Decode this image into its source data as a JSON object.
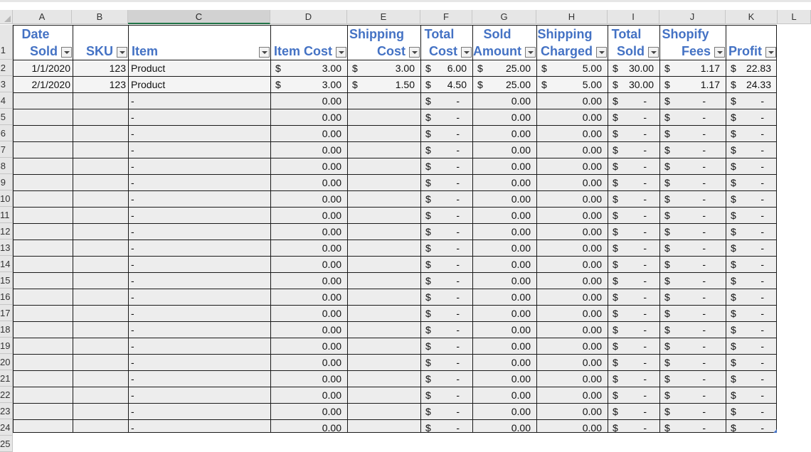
{
  "columns": [
    "A",
    "B",
    "C",
    "D",
    "E",
    "F",
    "G",
    "H",
    "I",
    "J",
    "K",
    "L"
  ],
  "row_numbers": [
    "1",
    "2",
    "3",
    "4",
    "5",
    "6",
    "7",
    "8",
    "9",
    "10",
    "11",
    "12",
    "13",
    "14",
    "15",
    "16",
    "17",
    "18",
    "19",
    "20",
    "21",
    "22",
    "23",
    "24",
    "25"
  ],
  "headers": {
    "date_sold": [
      "Date",
      "Sold"
    ],
    "sku": "SKU",
    "item": "Item",
    "item_cost": "Item Cost",
    "shipping_cost": [
      "Shipping",
      "Cost"
    ],
    "total_cost": [
      "Total",
      "Cost"
    ],
    "sold_amount": [
      "Sold",
      "Amount"
    ],
    "shipping_charged": [
      "Shipping",
      "Charged"
    ],
    "total_sold": [
      "Total",
      "Sold"
    ],
    "shopify_fees": [
      "Shopify",
      "Fees"
    ],
    "profit": "Profit"
  },
  "rows": [
    {
      "date": "1/1/2020",
      "sku": "123",
      "item": "Product",
      "item_cost": "3.00",
      "ship_cost": "3.00",
      "total_cost": "6.00",
      "sold_amount": "25.00",
      "ship_charged": "5.00",
      "total_sold": "30.00",
      "fees": "1.17",
      "profit": "22.83"
    },
    {
      "date": "2/1/2020",
      "sku": "123",
      "item": "Product",
      "item_cost": "3.00",
      "ship_cost": "1.50",
      "total_cost": "4.50",
      "sold_amount": "25.00",
      "ship_charged": "5.00",
      "total_sold": "30.00",
      "fees": "1.17",
      "profit": "24.33"
    }
  ],
  "empty_rows": {
    "count": 22,
    "item": "-",
    "item_cost": "0.00",
    "dash": "-",
    "sold_amount": "0.00",
    "ship_charged": "0.00"
  },
  "currency_symbol": "$",
  "colors": {
    "header_text": "#4472c4",
    "grid": "#1a1a1a",
    "selected_col": "#217346"
  }
}
